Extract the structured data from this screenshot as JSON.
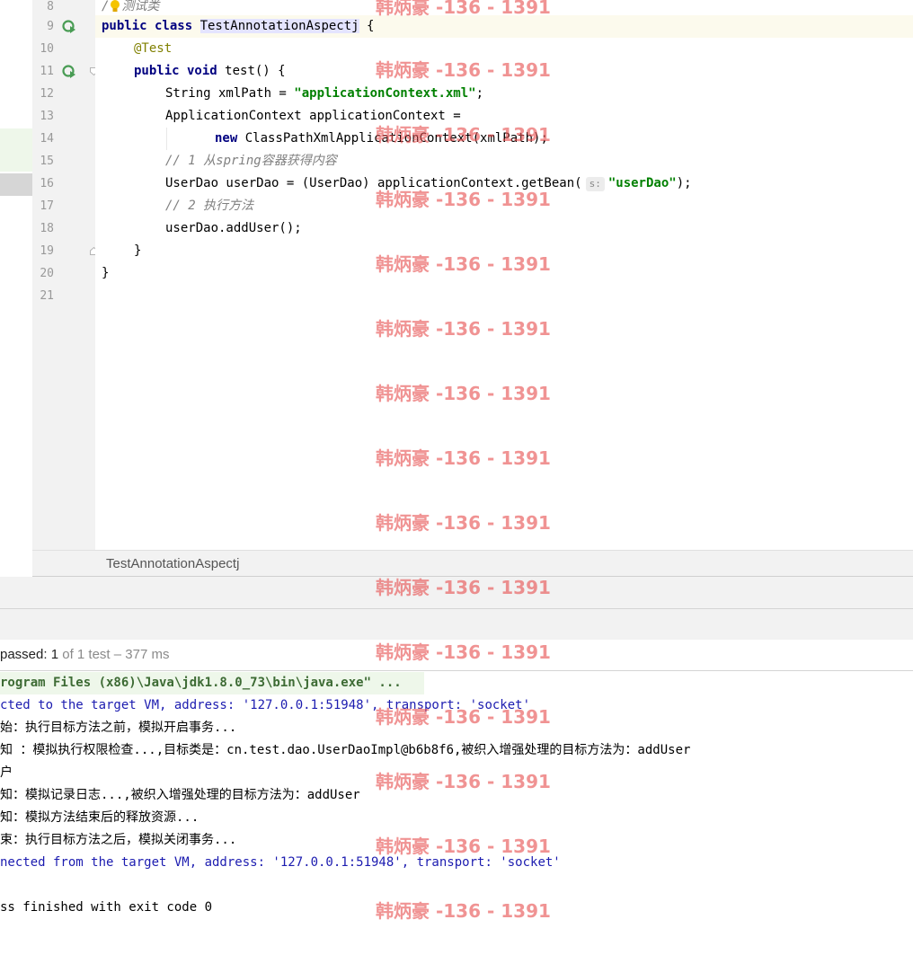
{
  "editor": {
    "line_numbers": [
      "8",
      "9",
      "10",
      "11",
      "12",
      "13",
      "14",
      "15",
      "16",
      "17",
      "18",
      "19",
      "20",
      "21"
    ],
    "lines": {
      "l8_comment_pre": "/",
      "l8_comment_post": "测试类",
      "l9_kw": "public class ",
      "l9_name": "TestAnnotationAspectj",
      "l9_end": " {",
      "l10_ann": "@Test",
      "l11_kw": "public void ",
      "l11_rest": "test() {",
      "l12_pre": "String xmlPath = ",
      "l12_str": "\"applicationContext.xml\"",
      "l12_end": ";",
      "l13": "ApplicationContext applicationContext =",
      "l14_kw": "new ",
      "l14_rest": "ClassPathXmlApplicationContext(xmlPath);",
      "l15_comment": "// 1 从spring容器获得内容",
      "l16_pre": "UserDao userDao = (UserDao) applicationContext.getBean(",
      "l16_hint": "s:",
      "l16_str": "\"userDao\"",
      "l16_end": ");",
      "l17_comment": "// 2 执行方法",
      "l18": "userDao.addUser();",
      "l19": "}",
      "l20": "}"
    }
  },
  "breadcrumb": {
    "label": "TestAnnotationAspectj"
  },
  "test_status": {
    "passed_label": "passed:",
    "passed_count": "1",
    "rest": "of 1 test – 377 ms"
  },
  "console": {
    "lines": [
      "rogram Files (x86)\\Java\\jdk1.8.0_73\\bin\\java.exe\" ...",
      "cted to the target VM, address: '127.0.0.1:51948', transport: 'socket'",
      "始：执行目标方法之前，模拟开启事务...",
      "知 ：模拟执行权限检查...,目标类是：cn.test.dao.UserDaoImpl@b6b8f6,被织入增强处理的目标方法为：addUser",
      "户",
      "知：模拟记录日志...,被织入增强处理的目标方法为：addUser",
      "知：模拟方法结束后的释放资源...",
      "束：执行目标方法之后，模拟关闭事务...",
      "nected from the target VM, address: '127.0.0.1:51948', transport: 'socket'",
      "",
      "ss finished with exit code 0"
    ]
  },
  "watermark": {
    "text": "韩炳豪 -136 - 1391"
  },
  "colors": {
    "keyword": "#000080",
    "string": "#008000",
    "annotation": "#808000",
    "comment": "#808080",
    "watermark": "#e65050"
  }
}
